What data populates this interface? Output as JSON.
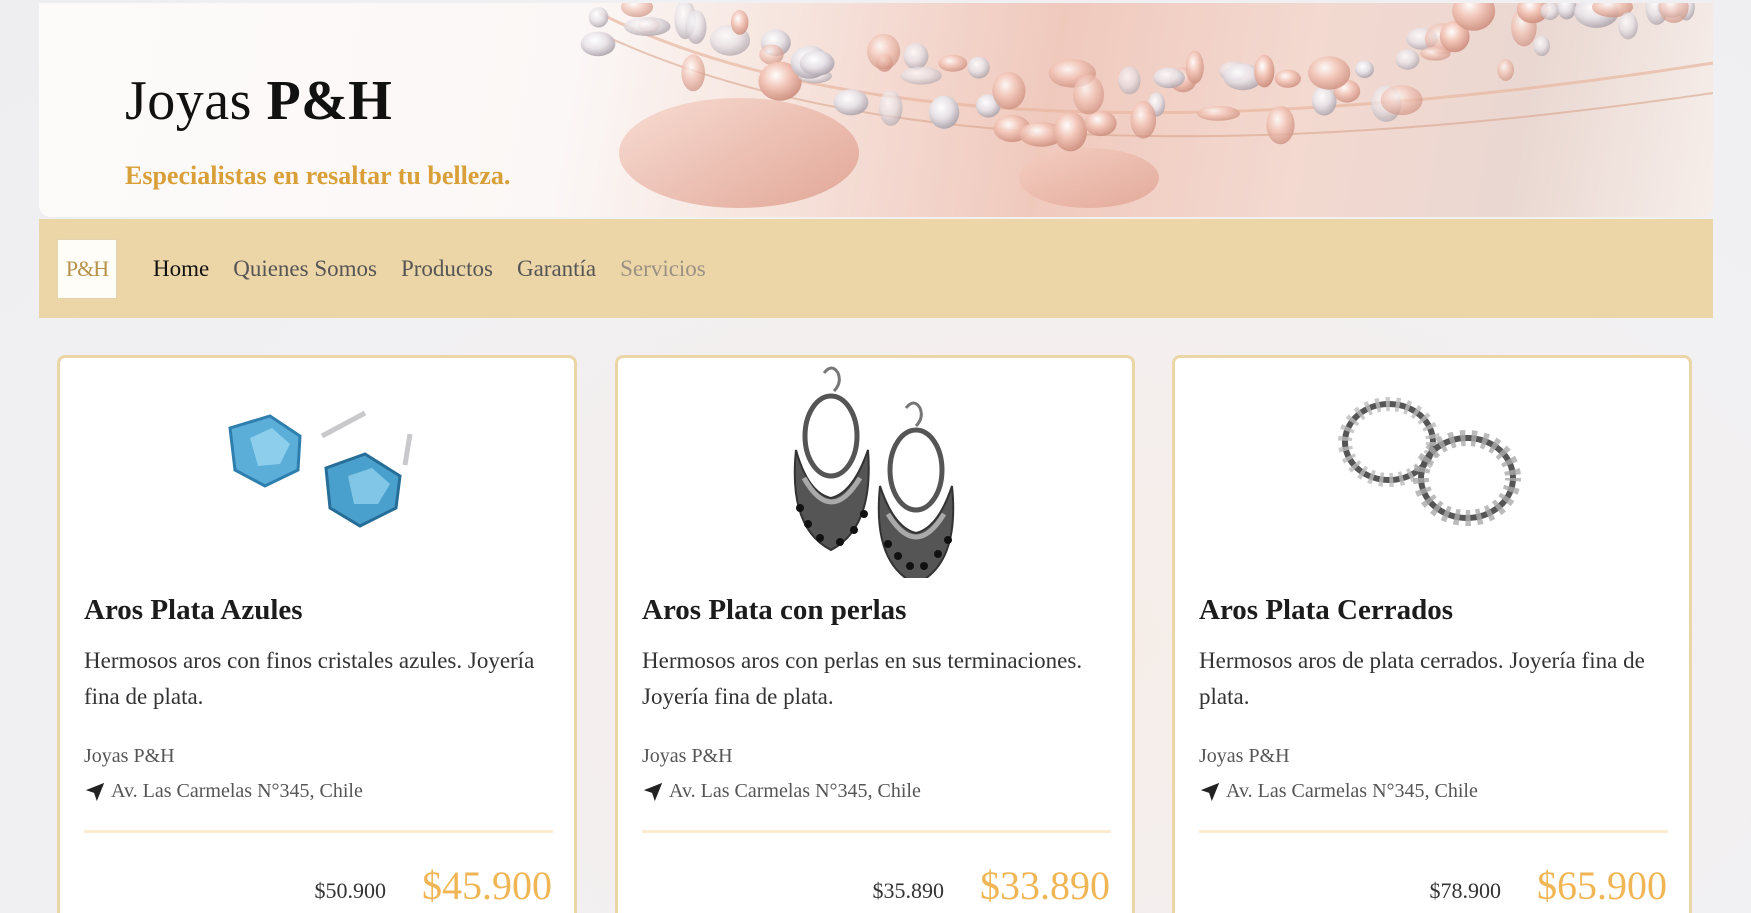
{
  "header": {
    "title_regular": "Joyas",
    "title_bold": "P&H",
    "tagline": "Especialistas en resaltar tu belleza."
  },
  "nav": {
    "logo_text": "P&H",
    "items": [
      {
        "label": "Home",
        "state": "active"
      },
      {
        "label": "Quienes Somos",
        "state": "normal"
      },
      {
        "label": "Productos",
        "state": "normal"
      },
      {
        "label": "Garantía",
        "state": "normal"
      },
      {
        "label": "Servicios",
        "state": "disabled"
      }
    ]
  },
  "products": [
    {
      "title": "Aros Plata Azules",
      "description": "Hermosos aros con finos cristales azules. Joyería fina de plata.",
      "brand": "Joyas P&H",
      "address": "Av. Las Carmelas N°345, Chile",
      "old_price": "$50.900",
      "price": "$45.900",
      "image": "blue-crystal-stud-earrings"
    },
    {
      "title": "Aros Plata con perlas",
      "description": "Hermosos aros con perlas en sus terminaciones. Joyería fina de plata.",
      "brand": "Joyas P&H",
      "address": "Av. Las Carmelas N°345, Chile",
      "old_price": "$35.890",
      "price": "$33.890",
      "image": "silver-chandbali-earrings"
    },
    {
      "title": "Aros Plata Cerrados",
      "description": "Hermosos aros de plata cerrados. Joyería fina de plata.",
      "brand": "Joyas P&H",
      "address": "Av. Las Carmelas N°345, Chile",
      "old_price": "$78.900",
      "price": "$65.900",
      "image": "silver-hoop-earrings"
    }
  ],
  "colors": {
    "nav_bg": "#ecd6a8",
    "tagline": "#d9a03a",
    "price": "#f0b656",
    "card_border": "#ecd6a8"
  }
}
